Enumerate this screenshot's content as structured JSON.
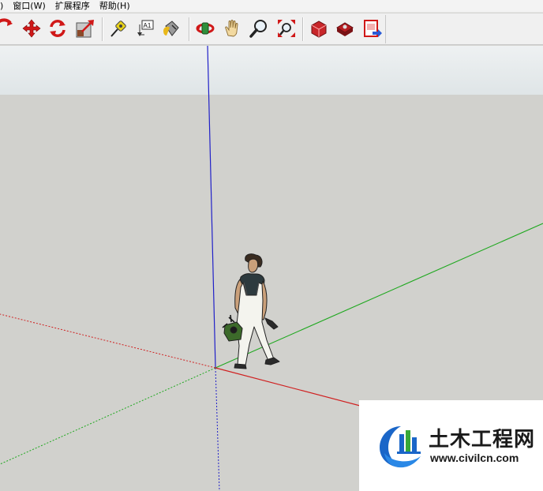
{
  "menu": {
    "items": [
      {
        "label": ")"
      },
      {
        "label": "窗口(W)"
      },
      {
        "label": "扩展程序"
      },
      {
        "label": "帮助(H)"
      }
    ]
  },
  "toolbar": {
    "tools": [
      {
        "icon": "follow-me-icon"
      },
      {
        "icon": "move-icon"
      },
      {
        "icon": "rotate-icon"
      },
      {
        "icon": "scale-icon"
      },
      {
        "icon": "tape-measure-icon"
      },
      {
        "icon": "text-icon",
        "glyph": "A1"
      },
      {
        "icon": "paint-bucket-icon"
      },
      {
        "icon": "orbit-icon"
      },
      {
        "icon": "pan-icon"
      },
      {
        "icon": "zoom-icon"
      },
      {
        "icon": "zoom-extents-icon"
      },
      {
        "icon": "3d-warehouse-icon"
      },
      {
        "icon": "extension-warehouse-icon"
      },
      {
        "icon": "send-to-layout-icon"
      }
    ]
  },
  "colors": {
    "axis_red": "#d02020",
    "axis_green": "#1fa81f",
    "axis_blue": "#2020c8",
    "ground": "#d1d1cd",
    "sky": "#e6ebed"
  },
  "watermark": {
    "title": "土木工程网",
    "url": "www.civilcn.com"
  }
}
